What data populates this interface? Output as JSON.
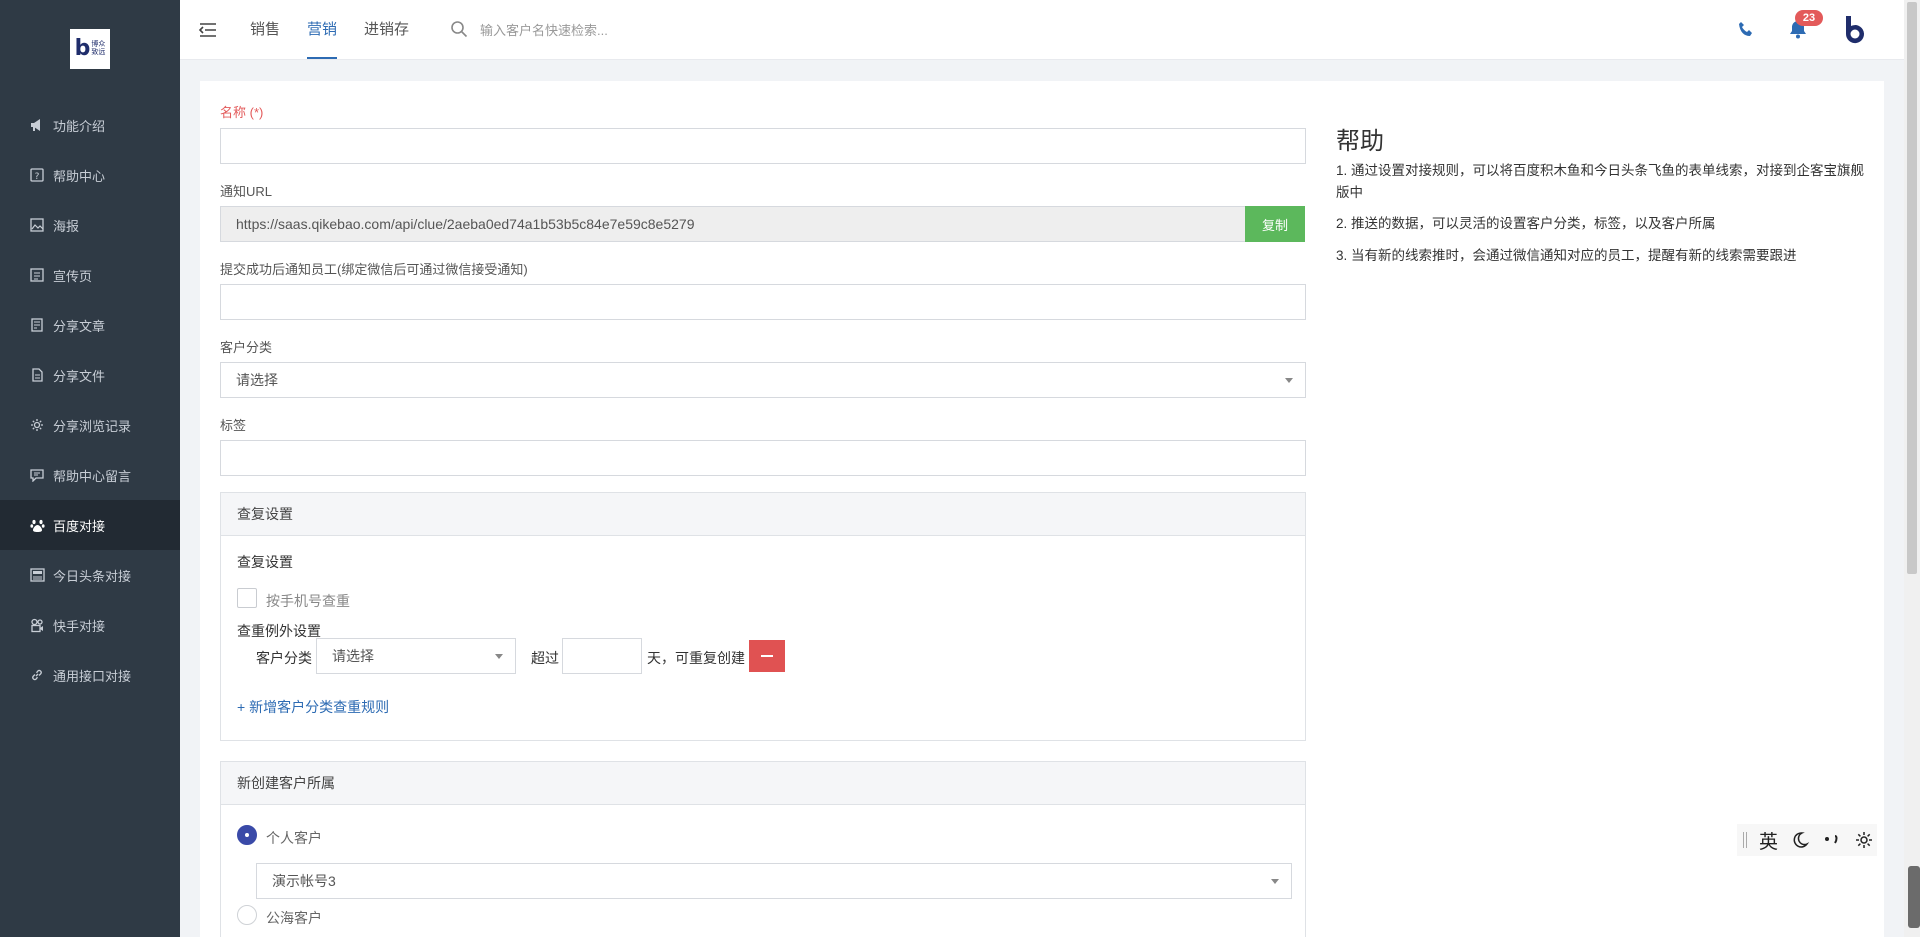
{
  "sidebar": {
    "logo_text_1": "博众",
    "logo_text_2": "致远",
    "items": [
      {
        "label": "功能介绍",
        "icon": "megaphone-icon"
      },
      {
        "label": "帮助中心",
        "icon": "help-icon"
      },
      {
        "label": "海报",
        "icon": "image-icon"
      },
      {
        "label": "宣传页",
        "icon": "page-icon"
      },
      {
        "label": "分享文章",
        "icon": "article-icon"
      },
      {
        "label": "分享文件",
        "icon": "file-icon"
      },
      {
        "label": "分享浏览记录",
        "icon": "gear-icon"
      },
      {
        "label": "帮助中心留言",
        "icon": "message-icon"
      },
      {
        "label": "百度对接",
        "icon": "paw-icon"
      },
      {
        "label": "今日头条对接",
        "icon": "news-icon"
      },
      {
        "label": "快手对接",
        "icon": "video-icon"
      },
      {
        "label": "通用接口对接",
        "icon": "link-icon"
      }
    ],
    "active": "百度对接"
  },
  "topbar": {
    "tabs": [
      "销售",
      "营销",
      "进销存"
    ],
    "active_tab": "营销",
    "search_placeholder": "输入客户名快速检索...",
    "notification_count": "23"
  },
  "form": {
    "name_label": "名称 (*)",
    "name_value": "",
    "url_label": "通知URL",
    "url_value": "https://saas.qikebao.com/api/clue/2aeba0ed74a1b53b5c84e7e59c8e5279",
    "copy_label": "复制",
    "notify_label": "提交成功后通知员工(绑定微信后可通过微信接受通知)",
    "notify_value": "",
    "category_label": "客户分类",
    "category_value": "请选择",
    "tags_label": "标签",
    "tags_value": ""
  },
  "dedup": {
    "title": "查复设置",
    "sub_label": "查复设置",
    "phone_check_label": "按手机号查重",
    "phone_check_checked": false,
    "exception_label": "查重例外设置",
    "row_category_label": "客户分类",
    "row_category_value": "请选择",
    "exceed_label": "超过",
    "days_value": "",
    "days_suffix": "天，可重复创建",
    "add_rule_label": "+ 新增客户分类查重规则"
  },
  "owner": {
    "title": "新创建客户所属",
    "personal_label": "个人客户",
    "personal_selected": true,
    "account_value": "演示帐号3",
    "public_label": "公海客户"
  },
  "help": {
    "title": "帮助",
    "lines": [
      "1. 通过设置对接规则，可以将百度积木鱼和今日头条飞鱼的表单线索，对接到企客宝旗舰版中",
      "2. 推送的数据，可以灵活的设置客户分类，标签，以及客户所属",
      "3. 当有新的线索推时，会通过微信通知对应的员工，提醒有新的线索需要跟进"
    ]
  },
  "ime": {
    "lang": "英"
  },
  "colors": {
    "sidebar_bg": "#2f3a45",
    "accent": "#2d6bb3",
    "copy_button": "#5cb85c",
    "danger": "#e05252",
    "required": "#e35a5a"
  }
}
